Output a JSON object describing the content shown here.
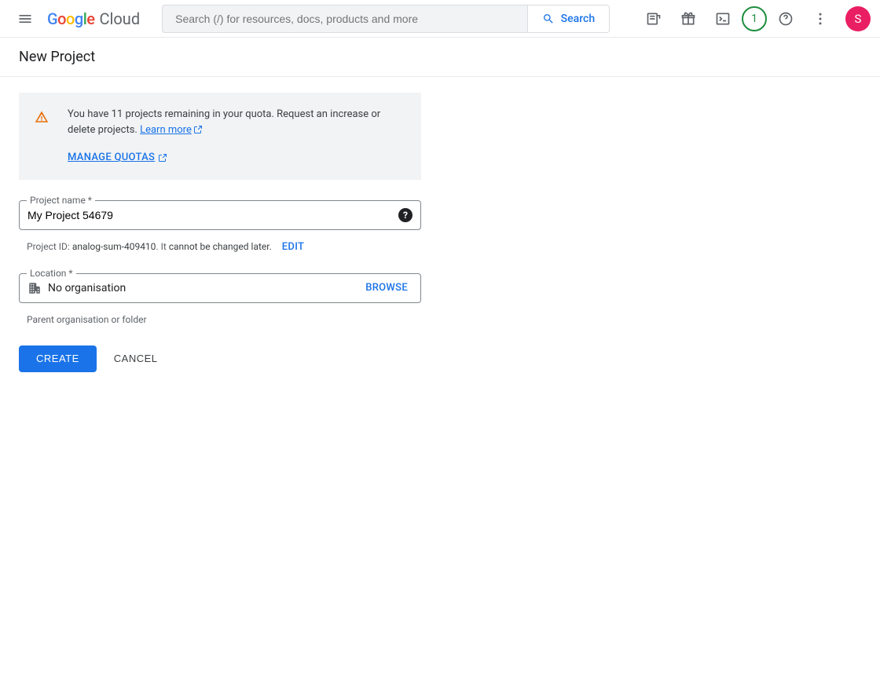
{
  "header": {
    "logo": {
      "google": "Google",
      "cloud": "Cloud"
    },
    "search_placeholder": "Search (/) for resources, docs, products and more",
    "search_button": "Search",
    "trial_badge": "1",
    "avatar_initial": "S"
  },
  "page": {
    "title": "New Project"
  },
  "alert": {
    "message_prefix": "You have ",
    "remaining_count": "11",
    "message_suffix": " projects remaining in your quota. Request an increase or delete projects. ",
    "learn_more": "Learn more",
    "manage_quotas": "MANAGE QUOTAS"
  },
  "form": {
    "project_name": {
      "label": "Project name *",
      "value": "My Project 54679"
    },
    "project_id": {
      "prefix": "Project ID: ",
      "id": "analog-sum-409410",
      "note_sep": ". It ",
      "note": "cannot be changed later.",
      "edit": "EDIT"
    },
    "location": {
      "label": "Location *",
      "value": "No organisation",
      "browse": "BROWSE",
      "hint": "Parent organisation or folder"
    },
    "actions": {
      "create": "CREATE",
      "cancel": "CANCEL"
    }
  }
}
